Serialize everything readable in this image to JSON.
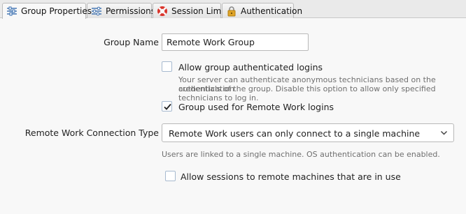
{
  "tabs": [
    {
      "label": "Group Properties",
      "icon": "sliders-icon",
      "active": true
    },
    {
      "label": "Permissions",
      "icon": "list-settings-icon",
      "active": false
    },
    {
      "label": "Session Limits",
      "icon": "lifebuoy-icon",
      "active": false
    },
    {
      "label": "Authentication",
      "icon": "padlock-icon",
      "active": false
    }
  ],
  "form": {
    "group_name_label": "Group Name",
    "group_name_value": "Remote Work Group",
    "allow_auth_logins": {
      "label": "Allow group authenticated logins",
      "checked": false,
      "help_line1": "Your server can authenticate anonymous technicians based on the authentication",
      "help_line2": "credentials of the group. Disable this option to allow only specified technicians to log in."
    },
    "remote_work_logins": {
      "label": "Group used for Remote Work logins",
      "checked": true
    },
    "connection_type_label": "Remote Work Connection Type",
    "connection_type_value": "Remote Work users can only connect to a single machine",
    "connection_type_help": "Users are linked to a single machine. OS authentication can be enabled.",
    "allow_in_use": {
      "label": "Allow sessions to remote machines that are in use",
      "checked": false
    }
  },
  "colors": {
    "accent_blue": "#3a6fb0",
    "lifebuoy_red": "#d9342b",
    "padlock_gold": "#e0a528"
  }
}
